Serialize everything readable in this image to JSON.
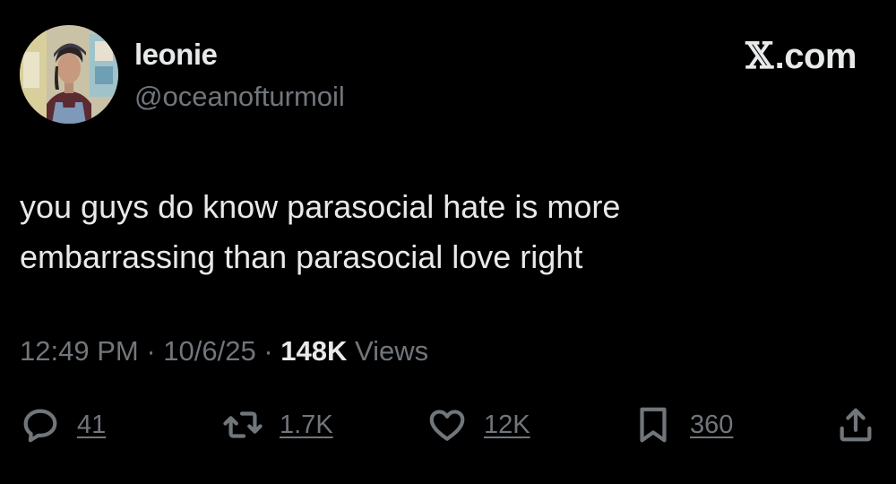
{
  "user": {
    "display_name": "leonie",
    "handle": "@oceanofturmoil",
    "avatar_alt": "profile photo"
  },
  "brand": {
    "name": ".com",
    "mark": "𝕏"
  },
  "tweet": {
    "text": "you guys do know parasocial hate is more\nembarrassing than parasocial love right",
    "time": "12:49 PM",
    "date": "10/6/25",
    "views_count": "148K",
    "views_label": "Views",
    "separator": "·"
  },
  "actions": {
    "reply_count": "41",
    "retweet_count": "1.7K",
    "like_count": "12K",
    "bookmark_count": "360"
  },
  "colors": {
    "background": "#000000",
    "primary_text": "#e7e9ea",
    "secondary_text": "#71767b"
  }
}
